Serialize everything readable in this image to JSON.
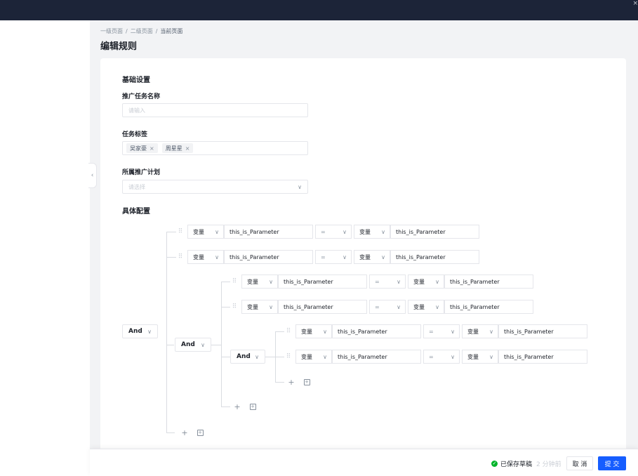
{
  "breadcrumb": [
    "一级页面",
    "二级页面",
    "当前页面"
  ],
  "page_title": "编辑规则",
  "basic": {
    "section_title": "基础设置",
    "task_name_label": "推广任务名称",
    "task_name_placeholder": "请输入",
    "tags_label": "任务标签",
    "tags": [
      "吴家豪",
      "周星星"
    ],
    "plan_label": "所属推广计划",
    "plan_placeholder": "请选择"
  },
  "config": {
    "section_title": "具体配置",
    "groups": {
      "root": "And",
      "level2": "And",
      "level3": "And"
    },
    "rows": [
      {
        "var_type": "变量",
        "param": "this_is_Parameter",
        "op": "=",
        "val_type": "变量",
        "value": "this_is_Parameter"
      },
      {
        "var_type": "变量",
        "param": "this_is_Parameter",
        "op": "=",
        "val_type": "变量",
        "value": "this_is_Parameter"
      },
      {
        "var_type": "变量",
        "param": "this_is_Parameter",
        "op": "=",
        "val_type": "变量",
        "value": "this_is_Parameter"
      },
      {
        "var_type": "变量",
        "param": "this_is_Parameter",
        "op": "=",
        "val_type": "变量",
        "value": "this_is_Parameter"
      },
      {
        "var_type": "变量",
        "param": "this_is_Parameter",
        "op": "=",
        "val_type": "变量",
        "value": "this_is_Parameter"
      },
      {
        "var_type": "变量",
        "param": "this_is_Parameter",
        "op": "=",
        "val_type": "变量",
        "value": "this_is_Parameter"
      }
    ]
  },
  "footer": {
    "saved_status": "已保存草稿",
    "saved_time": "2 分钟前",
    "cancel_label": "取 消",
    "submit_label": "提 交"
  },
  "colors": {
    "topbar": "#1c2438",
    "primary": "#165dff",
    "success": "#00b42a"
  }
}
